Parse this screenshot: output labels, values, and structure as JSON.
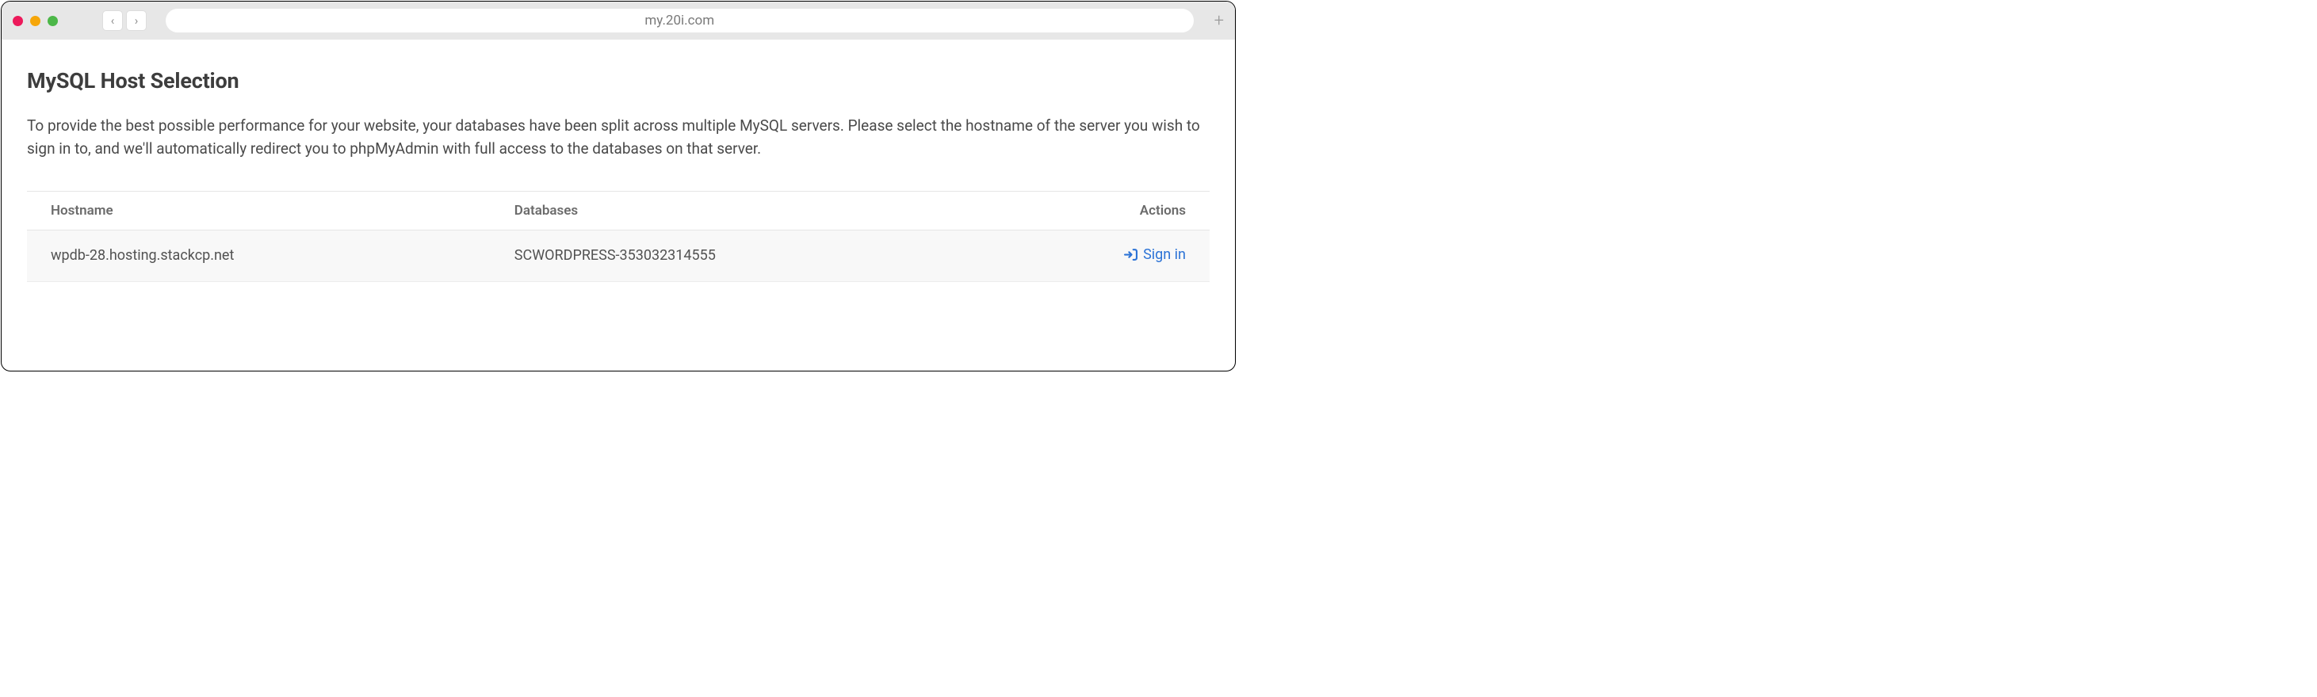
{
  "browser": {
    "url": "my.20i.com"
  },
  "page": {
    "title": "MySQL Host Selection",
    "description": "To provide the best possible performance for your website, your databases have been split across multiple MySQL servers. Please select the hostname of the server you wish to sign in to, and we'll automatically redirect you to phpMyAdmin with full access to the databases on that server."
  },
  "table": {
    "headers": {
      "hostname": "Hostname",
      "databases": "Databases",
      "actions": "Actions"
    },
    "rows": [
      {
        "hostname": "wpdb-28.hosting.stackcp.net",
        "databases": "SCWORDPRESS-353032314555",
        "action_label": "Sign in"
      }
    ]
  }
}
